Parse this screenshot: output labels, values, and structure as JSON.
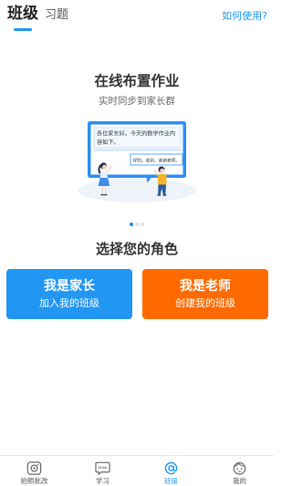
{
  "colors": {
    "accent": "#1E96F0",
    "title_text": "#333333",
    "muted_text": "#666666"
  },
  "header": {
    "tabs": [
      {
        "label": "班级",
        "active": true
      },
      {
        "label": "习题",
        "active": false
      }
    ],
    "help_link": "如何使用?"
  },
  "banner": {
    "title": "在线布置作业",
    "subtitle": "实时同步到家长群",
    "illustration": {
      "teacher_message_lines": [
        "各位家长好。今天的数学作业内",
        "容如下。"
      ],
      "parent_reply": "好的。收到。谢谢老师。"
    }
  },
  "carousel": {
    "page_count": 3,
    "active_index": 0
  },
  "roles": {
    "heading": "选择您的角色",
    "options": [
      {
        "title": "我是家长",
        "subtitle": "加入我的班级",
        "color": "#2196F3"
      },
      {
        "title": "我是老师",
        "subtitle": "创建我的班级",
        "color": "#FF6A00"
      }
    ]
  },
  "bottom_nav": {
    "items": [
      {
        "label": "拍照批改",
        "icon": "camera-icon",
        "active": false
      },
      {
        "label": "学习",
        "icon": "study-icon",
        "active": false
      },
      {
        "label": "班级",
        "icon": "class-icon",
        "active": true
      },
      {
        "label": "我的",
        "icon": "profile-icon",
        "active": false
      }
    ]
  }
}
